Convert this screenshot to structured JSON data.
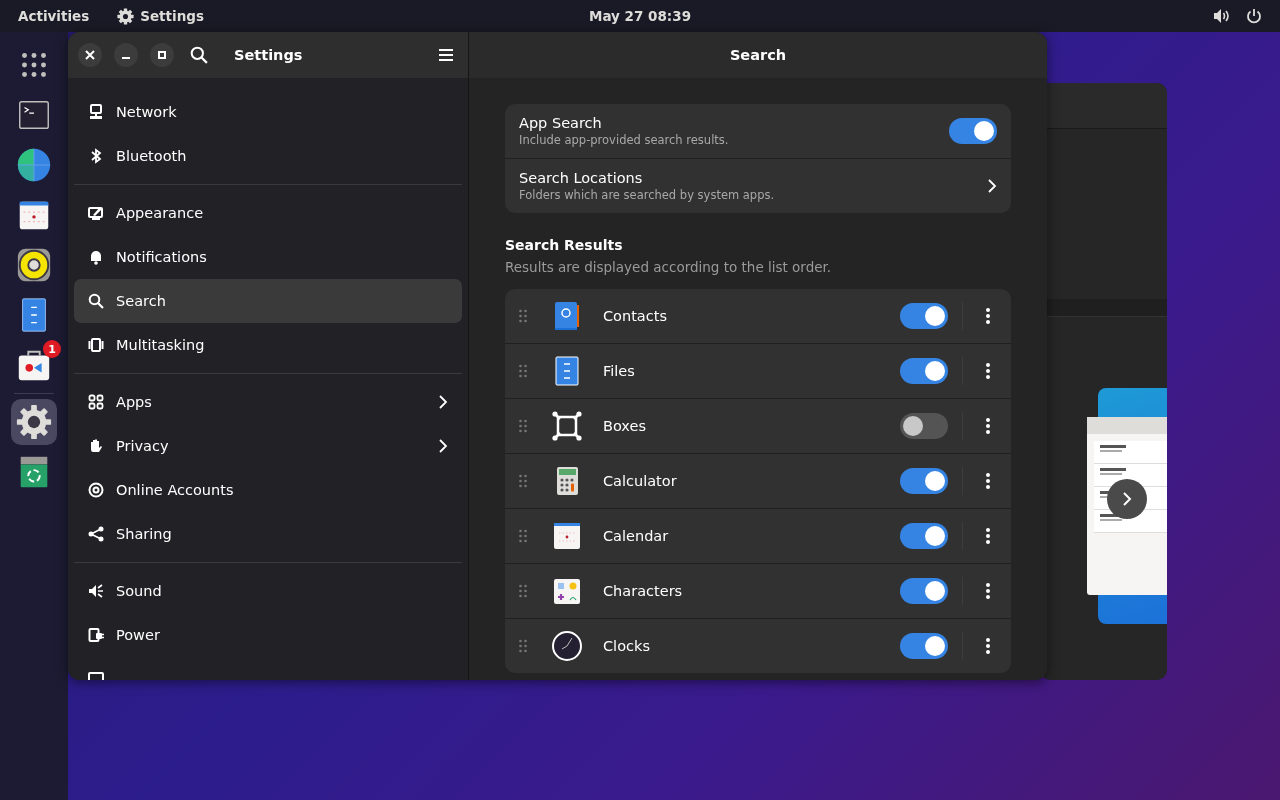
{
  "top_bar": {
    "activities": "Activities",
    "app_name": "Settings",
    "clock": "May 27  08:39"
  },
  "dock": [
    {
      "kind": "grid",
      "selected": false
    },
    {
      "kind": "terminal",
      "selected": false
    },
    {
      "kind": "browser",
      "selected": false
    },
    {
      "kind": "calendar",
      "selected": false
    },
    {
      "kind": "speaker",
      "selected": false
    },
    {
      "kind": "files",
      "selected": false
    },
    {
      "kind": "software",
      "selected": false,
      "badge": "1"
    },
    {
      "kind": "settings",
      "selected": true
    },
    {
      "kind": "trash",
      "selected": false
    }
  ],
  "settings_window": {
    "title": "Settings",
    "page_title": "Search",
    "sidebar": [
      [
        {
          "label": "Network",
          "kind": "network",
          "selected": false
        },
        {
          "label": "Bluetooth",
          "kind": "bluetooth",
          "selected": false
        }
      ],
      [
        {
          "label": "Appearance",
          "kind": "appearance",
          "selected": false
        },
        {
          "label": "Notifications",
          "kind": "bell",
          "selected": false
        },
        {
          "label": "Search",
          "kind": "search",
          "selected": true
        },
        {
          "label": "Multitasking",
          "kind": "multitask",
          "selected": false
        }
      ],
      [
        {
          "label": "Apps",
          "kind": "apps",
          "selected": false,
          "arrow": true
        },
        {
          "label": "Privacy",
          "kind": "hand",
          "selected": false,
          "arrow": true
        },
        {
          "label": "Online Accounts",
          "kind": "at",
          "selected": false,
          "arrow": false
        },
        {
          "label": "Sharing",
          "kind": "share",
          "selected": false,
          "arrow": false
        }
      ],
      [
        {
          "label": "Sound",
          "kind": "sound",
          "selected": false
        },
        {
          "label": "Power",
          "kind": "power",
          "selected": false
        },
        {
          "kind": "display",
          "selected": false
        }
      ]
    ],
    "app_search": {
      "title": "App Search",
      "subtitle": "Include app-provided search results.",
      "on": true
    },
    "search_locations": {
      "title": "Search Locations",
      "subtitle": "Folders which are searched by system apps."
    },
    "results_heading": "Search Results",
    "results_subtitle": "Results are displayed according to the list order.",
    "results": [
      {
        "name": "Contacts",
        "kind": "contacts",
        "on": true
      },
      {
        "name": "Files",
        "kind": "files",
        "on": true
      },
      {
        "name": "Boxes",
        "kind": "boxes",
        "on": false
      },
      {
        "name": "Calculator",
        "kind": "calculator",
        "on": true
      },
      {
        "name": "Calendar",
        "kind": "calendar",
        "on": true
      },
      {
        "name": "Characters",
        "kind": "characters",
        "on": true
      },
      {
        "name": "Clocks",
        "kind": "clocks",
        "on": true
      }
    ]
  }
}
